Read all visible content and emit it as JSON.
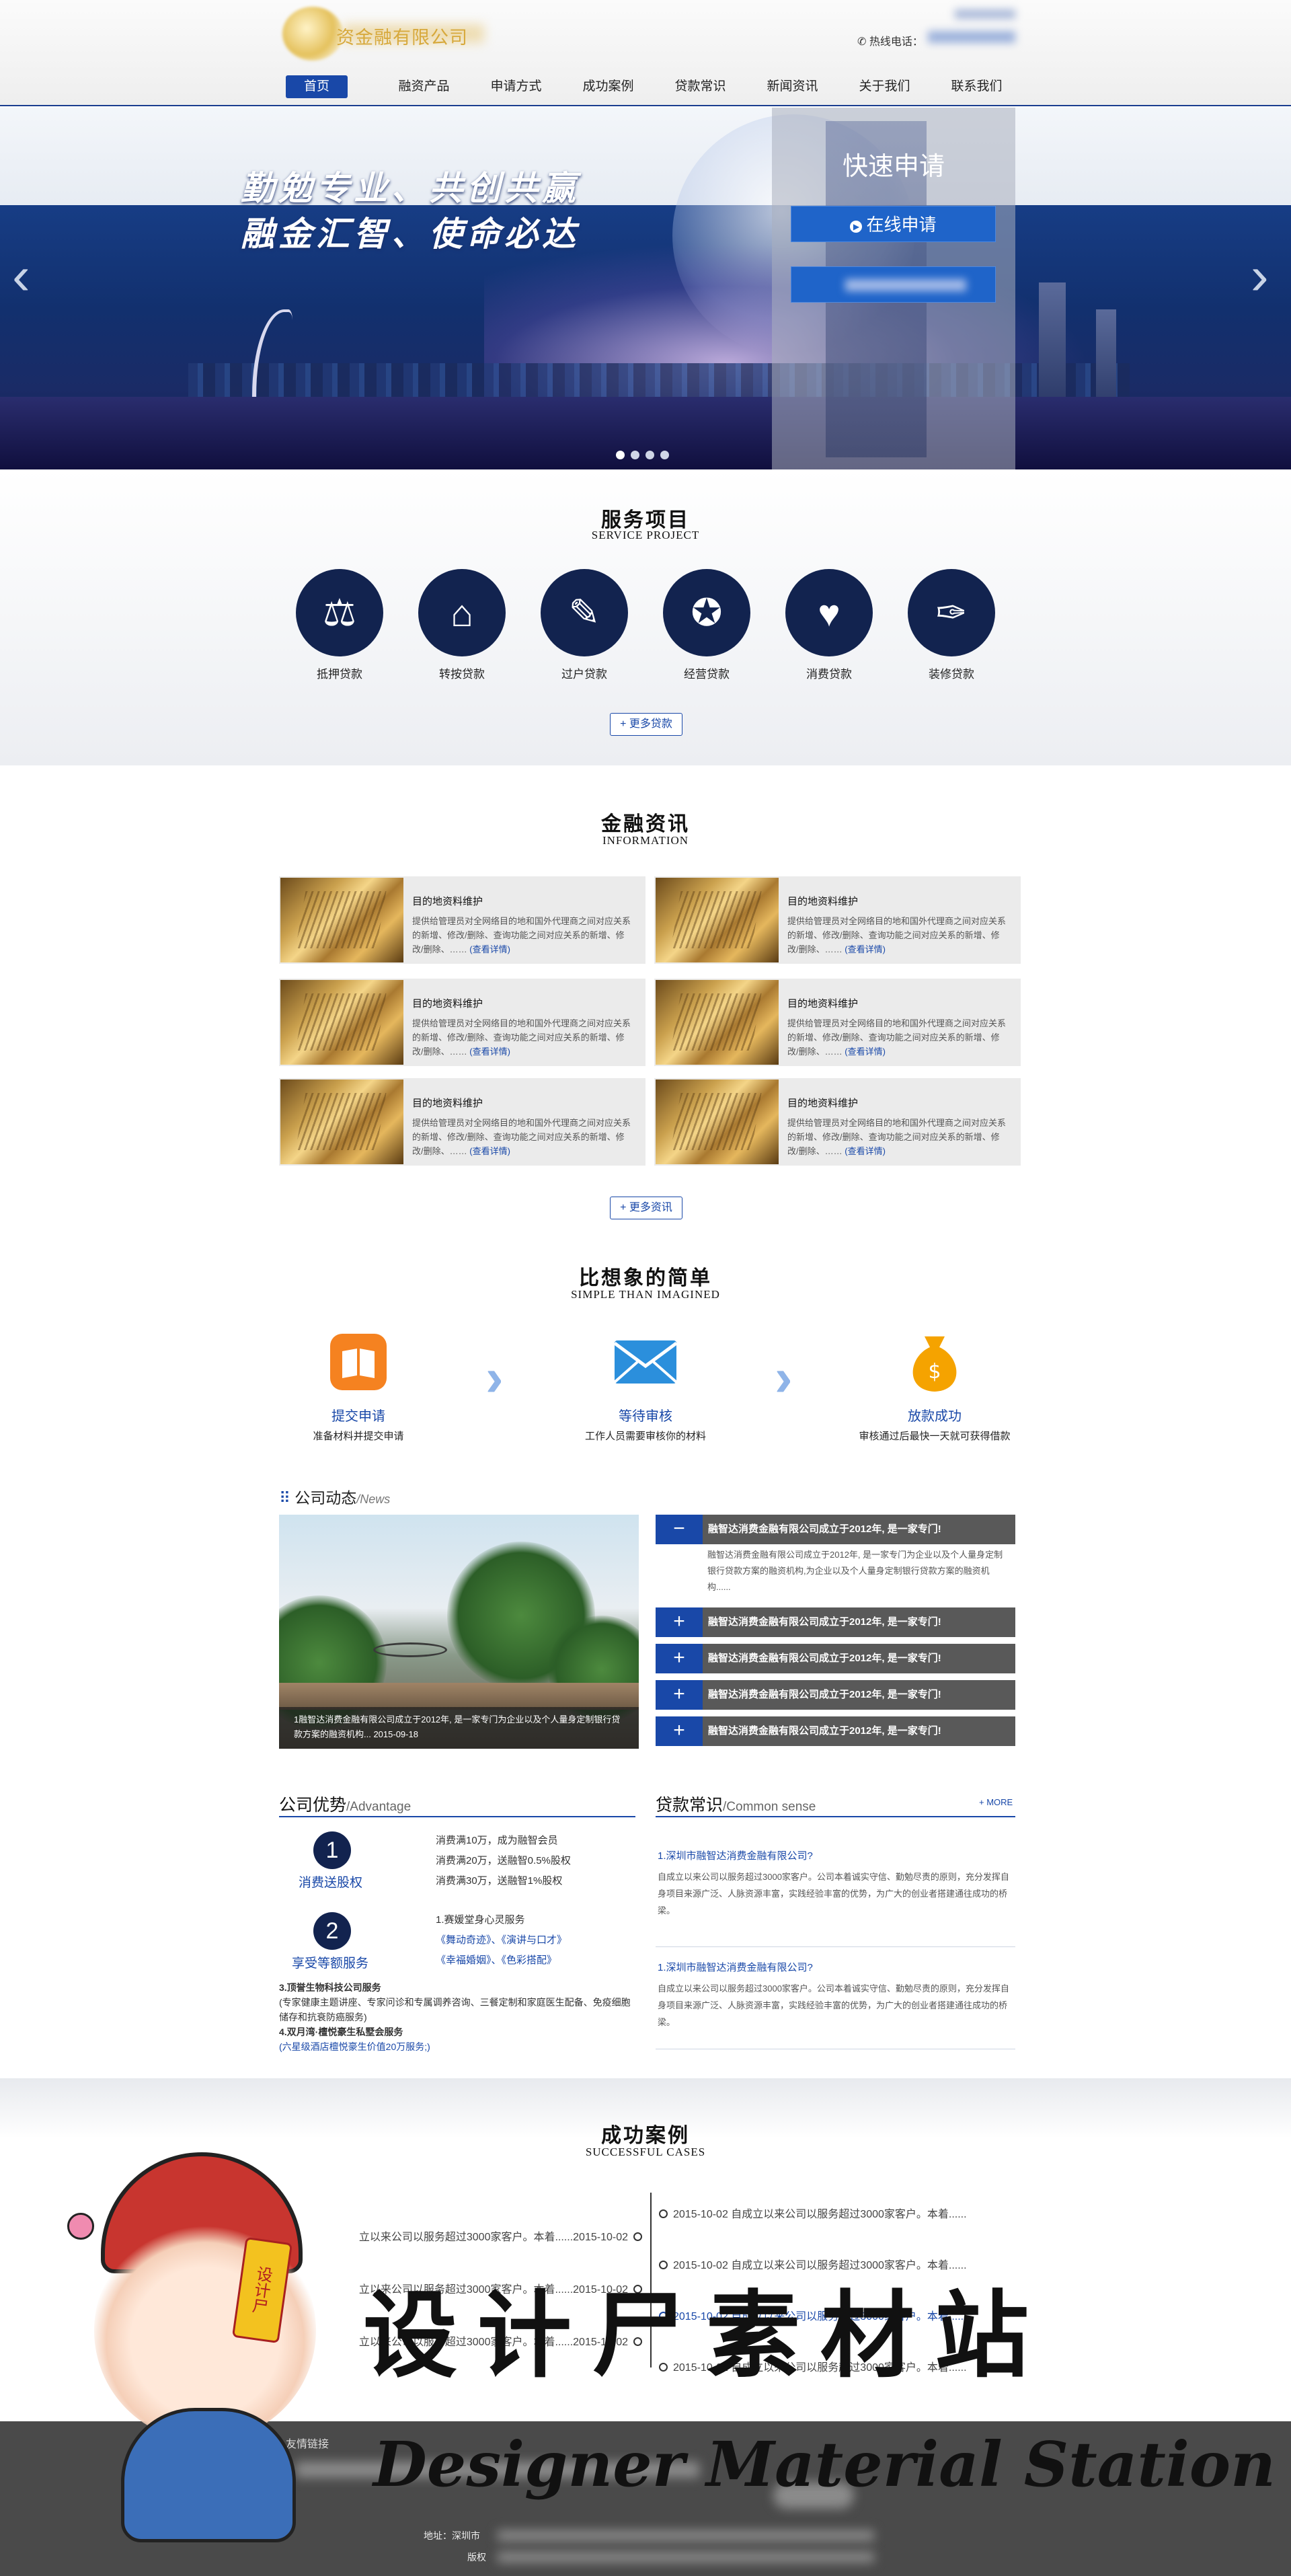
{
  "header": {
    "logo_text": "资金融有限公司",
    "hotline_label": "✆ 热线电话：",
    "nav": [
      "首页",
      "融资产品",
      "申请方式",
      "成功案例",
      "贷款常识",
      "新闻资讯",
      "关于我们",
      "联系我们"
    ]
  },
  "banner": {
    "slogan1": "勤勉专业、共创共赢",
    "slogan2": "融金汇智、使命必达",
    "quick_title": "快速申请",
    "apply_button": "在线申请",
    "prev_icon": "chevron-left-icon",
    "next_icon": "chevron-right-icon",
    "slide_dots": 4,
    "active_dot": 1
  },
  "service": {
    "title": "服务项目",
    "subtitle": "SERVICE PROJECT",
    "items": [
      {
        "label": "抵押贷款",
        "icon": "scale-icon"
      },
      {
        "label": "转按贷款",
        "icon": "house-icon"
      },
      {
        "label": "过户贷款",
        "icon": "transfer-icon"
      },
      {
        "label": "经营贷款",
        "icon": "award-icon"
      },
      {
        "label": "消费贷款",
        "icon": "bag-icon"
      },
      {
        "label": "装修贷款",
        "icon": "brush-icon"
      }
    ],
    "more_label": "+ 更多贷款"
  },
  "information": {
    "title": "金融资讯",
    "subtitle": "INFORMATION",
    "items": [
      {
        "title": "目的地资料维护",
        "desc": "提供给管理员对全网络目的地和国外代理商之间对应关系的新增、修改/删除、查询功能之间对应关系的新增、修改/删除、……",
        "link": "(查看详情)"
      },
      {
        "title": "目的地资料维护",
        "desc": "提供给管理员对全网络目的地和国外代理商之间对应关系的新增、修改/删除、查询功能之间对应关系的新增、修改/删除、……",
        "link": "(查看详情)"
      },
      {
        "title": "目的地资料维护",
        "desc": "提供给管理员对全网络目的地和国外代理商之间对应关系的新增、修改/删除、查询功能之间对应关系的新增、修改/删除、……",
        "link": "(查看详情)"
      },
      {
        "title": "目的地资料维护",
        "desc": "提供给管理员对全网络目的地和国外代理商之间对应关系的新增、修改/删除、查询功能之间对应关系的新增、修改/删除、……",
        "link": "(查看详情)"
      },
      {
        "title": "目的地资料维护",
        "desc": "提供给管理员对全网络目的地和国外代理商之间对应关系的新增、修改/删除、查询功能之间对应关系的新增、修改/删除、……",
        "link": "(查看详情)"
      },
      {
        "title": "目的地资料维护",
        "desc": "提供给管理员对全网络目的地和国外代理商之间对应关系的新增、修改/删除、查询功能之间对应关系的新增、修改/删除、……",
        "link": "(查看详情)"
      }
    ],
    "more_label": "+ 更多资讯"
  },
  "simple": {
    "title": "比想象的简单",
    "subtitle": "SIMPLE THAN IMAGINED",
    "steps": [
      {
        "title": "提交申请",
        "desc": "准备材料并提交申请",
        "icon": "book-icon"
      },
      {
        "title": "等待审核",
        "desc": "工作人员需要审核你的材料",
        "icon": "envelope-icon"
      },
      {
        "title": "放款成功",
        "desc": "审核通过后最快一天就可获得借款",
        "icon": "money-bag-icon"
      }
    ]
  },
  "news": {
    "title": "公司动态",
    "title_en": "/News",
    "photo_caption": "1融智达消费金融有限公司成立于2012年, 是一家专门为企业以及个人量身定制银行贷款方案的融资机构... 2015-09-18",
    "items": [
      {
        "title": "融智达消费金融有限公司成立于2012年, 是一家专门!",
        "open": true,
        "desc": "融智达消费金融有限公司成立于2012年, 是一家专门为企业以及个人量身定制银行贷款方案的融资机构,为企业以及个人量身定制银行贷款方案的融资机构......"
      },
      {
        "title": "融智达消费金融有限公司成立于2012年, 是一家专门!",
        "open": false
      },
      {
        "title": "融智达消费金融有限公司成立于2012年, 是一家专门!",
        "open": false
      },
      {
        "title": "融智达消费金融有限公司成立于2012年, 是一家专门!",
        "open": false
      },
      {
        "title": "融智达消费金融有限公司成立于2012年, 是一家专门!",
        "open": false
      }
    ]
  },
  "advantage": {
    "title": "公司优势",
    "title_en": "/Advantage",
    "badge1_label": "消费送股权",
    "badge2_label": "享受等额服务",
    "lines1": [
      "消费满10万，成为融智会员",
      "消费满20万，送融智0.5%股权",
      "消费满30万，送融智1%股权"
    ],
    "service1_title": "1.赛媛堂身心灵服务",
    "service1_items": "《舞动奇迹》、《演讲与口才》",
    "service1_items2": "《幸福婚姻》、《色彩搭配》",
    "service3": "3.顶誉生物科技公司服务",
    "service3_desc": "(专家健康主题讲座、专家问诊和专属调养咨询、三餐定制和家庭医生配备、免疫细胞储存和抗衰防癌服务)",
    "service4": "4.双月湾·檀悦豪生私墅会服务",
    "service4_desc": "(六星级酒店檀悦豪生价值20万服务;)"
  },
  "common": {
    "title": "贷款常识",
    "title_en": "/Common sense",
    "more": "+ MORE",
    "items": [
      {
        "title": "1.深圳市融智达消费金融有限公司?",
        "desc": "自成立以来公司以服务超过3000家客户。公司本着诚实守信、勤勉尽责的原则，充分发挥自身项目来源广泛、人脉资源丰富，实践经验丰富的优势，为广大的创业者搭建通往成功的桥梁。"
      },
      {
        "title": "1.深圳市融智达消费金融有限公司?",
        "desc": "自成立以来公司以服务超过3000家客户。公司本着诚实守信、勤勉尽责的原则，充分发挥自身项目来源广泛、人脉资源丰富，实践经验丰富的优势，为广大的创业者搭建通往成功的桥梁。"
      }
    ]
  },
  "cases": {
    "title": "成功案例",
    "subtitle": "SUCCESSFUL CASES",
    "left": [
      "立以来公司以服务超过3000家客户。本着......2015-10-02",
      "立以来公司以服务超过3000家客户。本着......2015-10-02",
      "立以来公司以服务超过3000家客户。本着......2015-10-02"
    ],
    "right": [
      "2015-10-02 自成立以来公司以服务超过3000家客户。本着......",
      "2015-10-02 自成立以来公司以服务超过3000家客户。本着......",
      "2015-10-02 自成立以来公司以服务超过3000家客户。本着......",
      "2015-10-02 自成立以来公司以服务超过3000家客户。本着......"
    ],
    "selected_right": 2
  },
  "footer": {
    "link_label": "友情链接",
    "address_label": "地址：深圳市",
    "copyright_label": "版权"
  },
  "watermark": {
    "cn": "设计尸素材站",
    "en": "Designer Material Station",
    "badge": "设计尸",
    "mascot_badge": "设计尸"
  },
  "colors": {
    "brand_blue": "#1948a8",
    "dark_navy": "#12234f",
    "gray_bar": "#595959"
  }
}
